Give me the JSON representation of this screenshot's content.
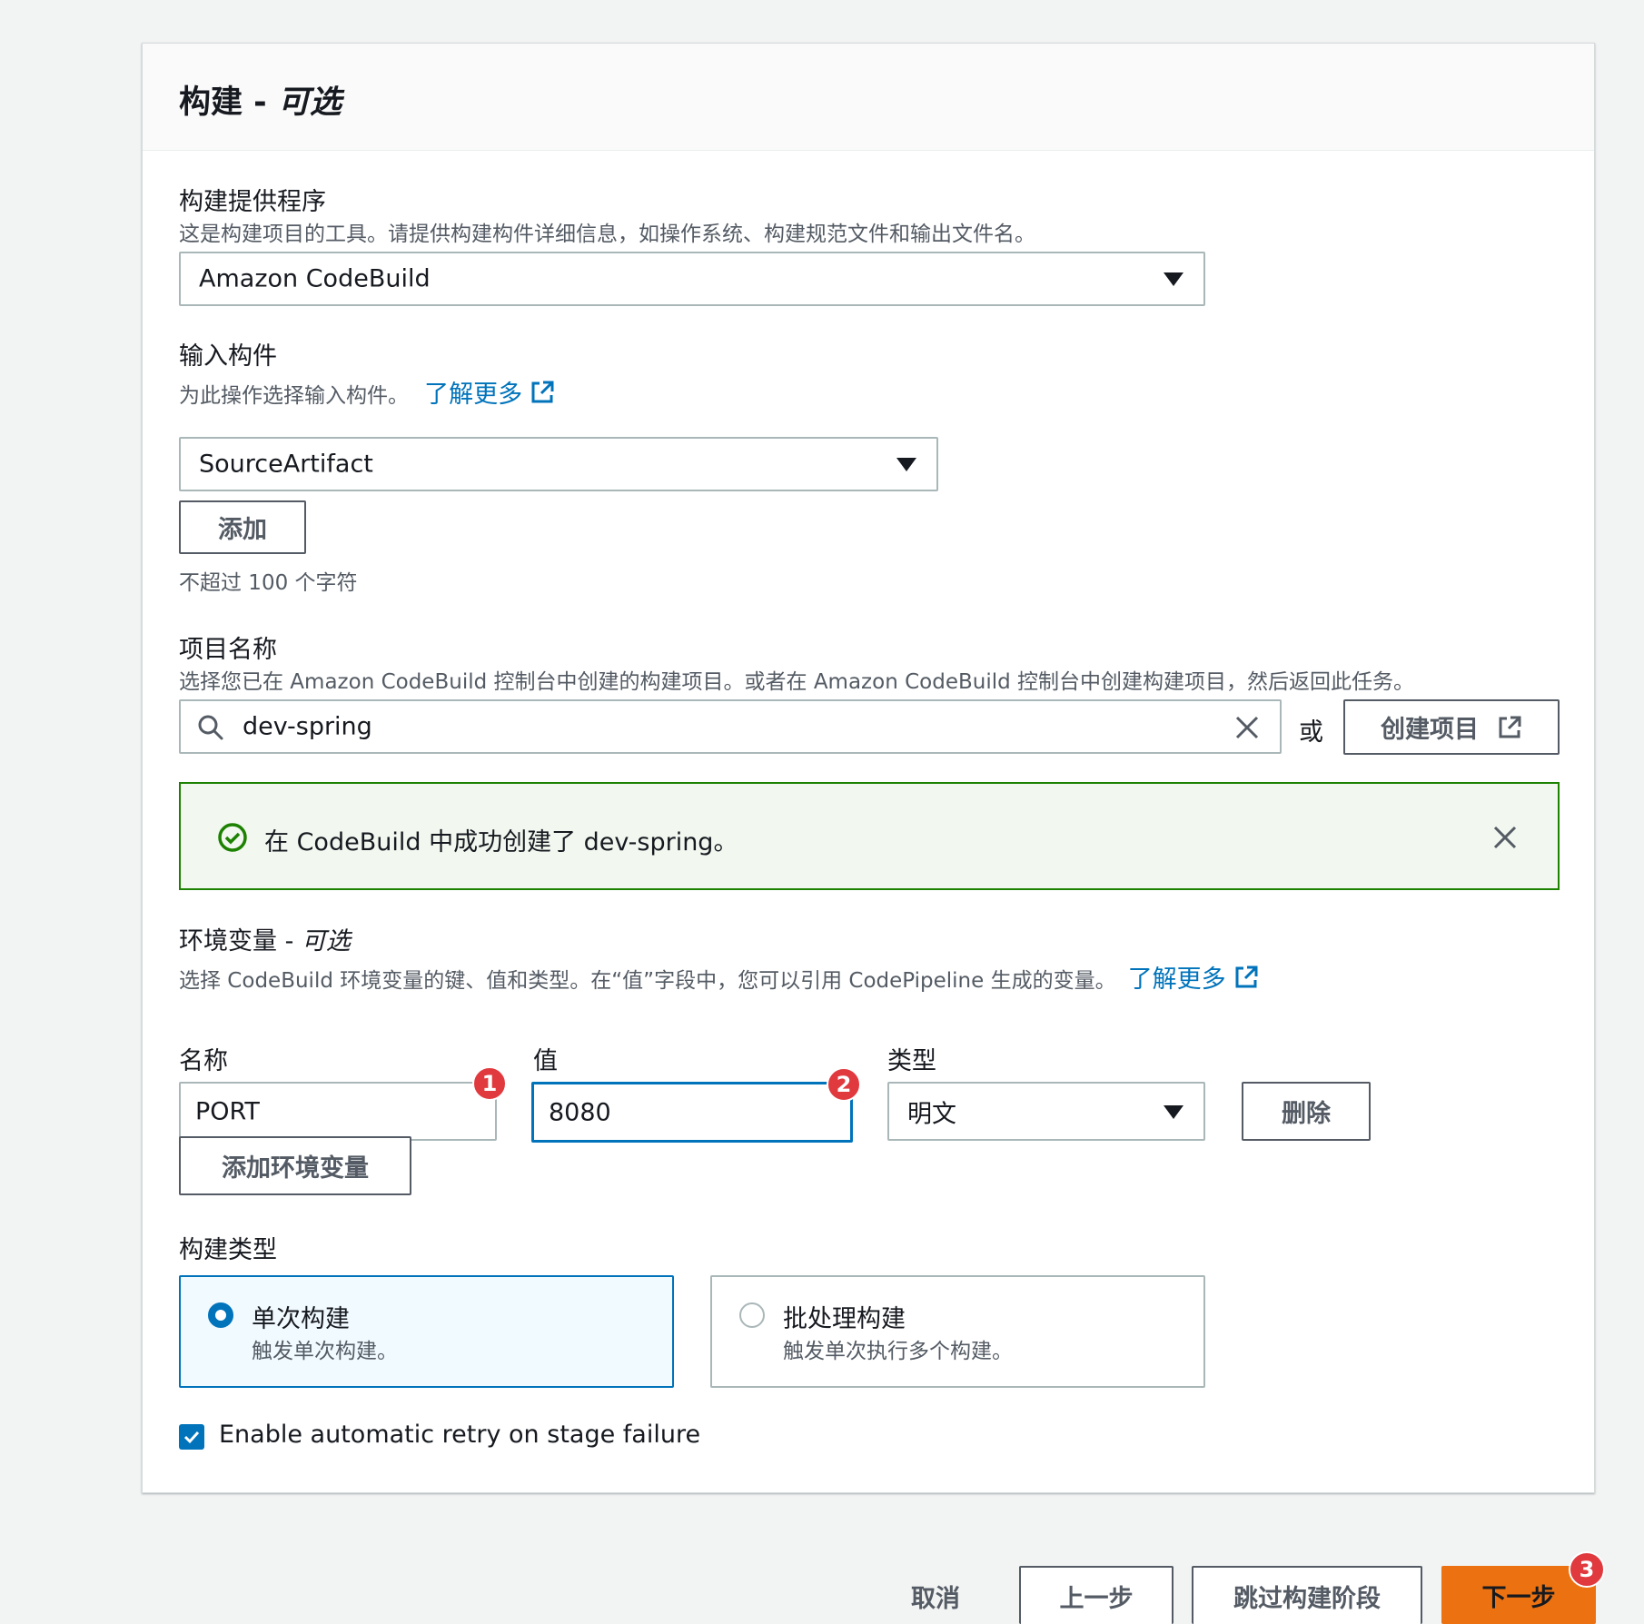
{
  "panel": {
    "title_main": "构建 - ",
    "title_optional": "可选"
  },
  "build_provider": {
    "label": "构建提供程序",
    "description": "这是构建项目的工具。请提供构建构件详细信息，如操作系统、构建规范文件和输出文件名。",
    "selected": "Amazon CodeBuild"
  },
  "input_artifacts": {
    "label": "输入构件",
    "description": "为此操作选择输入构件。",
    "learn_more": "了解更多",
    "selected": "SourceArtifact",
    "add_button": "添加",
    "constraint": "不超过 100 个字符"
  },
  "project_name": {
    "label": "项目名称",
    "description": "选择您已在 Amazon CodeBuild 控制台中创建的构建项目。或者在 Amazon CodeBuild 控制台中创建构建项目，然后返回此任务。",
    "search_value": "dev-spring",
    "or_text": "或",
    "create_button": "创建项目"
  },
  "success_alert": {
    "message": "在 CodeBuild 中成功创建了 dev-spring。"
  },
  "env_vars": {
    "label_main": "环境变量 - ",
    "label_optional": "可选",
    "description": "选择 CodeBuild 环境变量的键、值和类型。在“值”字段中，您可以引用 CodePipeline 生成的变量。",
    "learn_more": "了解更多",
    "col_name": "名称",
    "col_value": "值",
    "col_type": "类型",
    "rows": [
      {
        "name": "PORT",
        "value": "8080",
        "type": "明文"
      }
    ],
    "remove_button": "删除",
    "add_button": "添加环境变量",
    "badges": [
      "1",
      "2"
    ]
  },
  "build_type": {
    "label": "构建类型",
    "options": [
      {
        "title": "单次构建",
        "description": "触发单次构建。",
        "selected": true
      },
      {
        "title": "批处理构建",
        "description": "触发单次执行多个构建。",
        "selected": false
      }
    ]
  },
  "retry": {
    "label": "Enable automatic retry on stage failure",
    "checked": true
  },
  "footer": {
    "cancel": "取消",
    "previous": "上一步",
    "skip": "跳过构建阶段",
    "next": "下一步",
    "badge": "3"
  },
  "colors": {
    "link": "#0073bb",
    "success": "#1d8102",
    "primary": "#ec7211",
    "badge": "#e0393e"
  },
  "icons": [
    "external-link-icon",
    "search-icon",
    "clear-icon",
    "success-check-icon",
    "close-icon",
    "caret-down-icon",
    "checkmark-icon"
  ]
}
